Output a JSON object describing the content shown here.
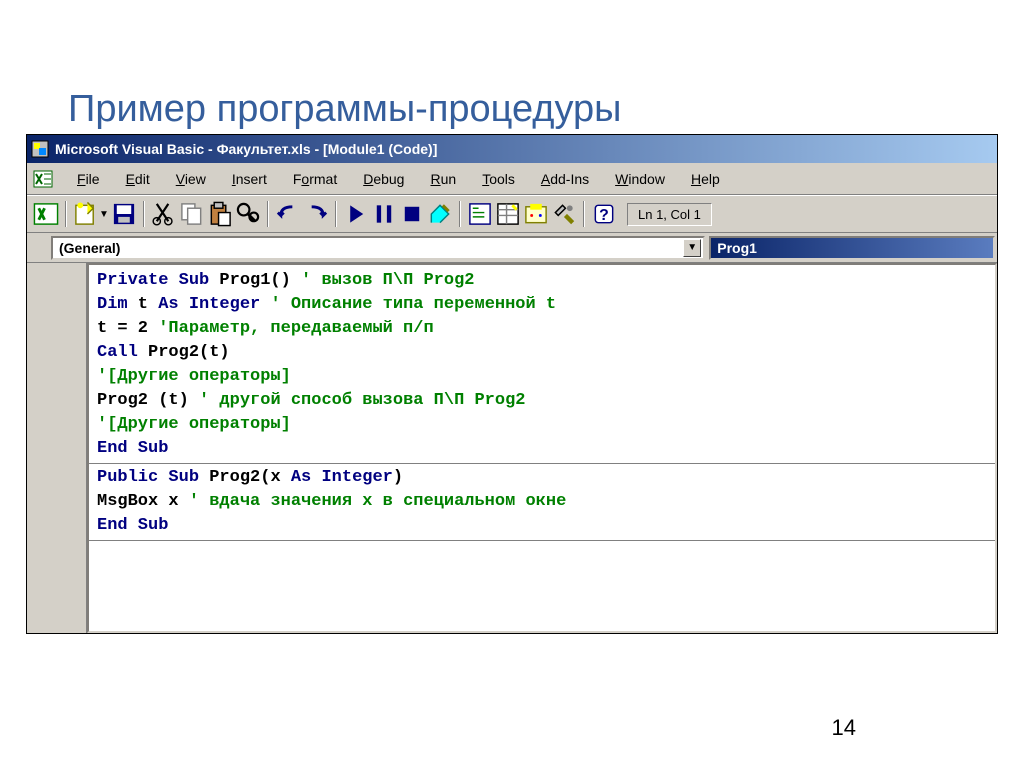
{
  "slide": {
    "title": "Пример программы-процедуры",
    "page_number": "14"
  },
  "titlebar": {
    "text": "Microsoft Visual Basic - Факультет.xls - [Module1 (Code)]"
  },
  "menu": {
    "file": "File",
    "edit": "Edit",
    "view": "View",
    "insert": "Insert",
    "format": "Format",
    "debug": "Debug",
    "run": "Run",
    "tools": "Tools",
    "addins": "Add-Ins",
    "window": "Window",
    "help": "Help"
  },
  "toolbar": {
    "cursor_pos": "Ln 1, Col 1"
  },
  "selectors": {
    "left": "(General)",
    "right": "Prog1"
  },
  "code": {
    "l1_kw1": "Private Sub",
    "l1_tx": " Prog1() ",
    "l1_cm": "' вызов П\\П Prog2",
    "l2_kw1": "Dim",
    "l2_tx1": " t ",
    "l2_kw2": "As Integer",
    "l2_tx2": " ",
    "l2_cm": "' Описание типа переменной t",
    "l3_tx": "t = 2 ",
    "l3_cm": "'Параметр, передаваемый п/п",
    "l4_kw": "Call",
    "l4_tx": " Prog2(t)",
    "l5_cm": "'[Другие операторы]",
    "l6_tx": "Prog2 (t) ",
    "l6_cm": "' другой способ вызова П\\П Prog2",
    "l7_cm": "'[Другие операторы]",
    "l8_kw": "End Sub",
    "l9_kw1": "Public Sub",
    "l9_tx1": " Prog2(x ",
    "l9_kw2": "As Integer",
    "l9_tx2": ")",
    "l10_tx": "MsgBox x ",
    "l10_cm": "' вдача значения x в специальном окне",
    "l11_kw": "End Sub"
  }
}
